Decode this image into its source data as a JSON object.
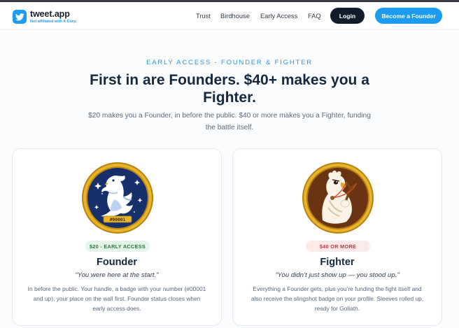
{
  "nav": {
    "brand_name": "tweet.app",
    "brand_sub": "Not affiliated with X Corp.",
    "links": [
      "Trust",
      "Birdhouse",
      "Early Access",
      "FAQ"
    ],
    "login_label": "Login",
    "cta_label": "Become a Founder"
  },
  "hero": {
    "eyebrow": "EARLY ACCESS - FOUNDER & FIGHTER",
    "headline": "First in are Founders. $40+ makes you a Fighter.",
    "subhead": "$20 makes you a Founder, in before the public. $40 or more makes you a Fighter, funding the battle itself."
  },
  "tiers": [
    {
      "badge_number": "#00001",
      "price": "$20 - EARLY ACCESS",
      "title": "Founder",
      "quote": "“You were here at the start.”",
      "body": "In before the public. Your handle, a badge with your number (#00001 and up), your place on the wall first. Founder status closes when early access does."
    },
    {
      "price": "$40 OR MORE",
      "title": "Fighter",
      "quote": "“You didn’t just show up — you stood up.”",
      "body": "Everything a Founder gets, plus you’re funding the fight itself and also receive the slingshot badge on your profile. Sleeves rolled up, ready for Goliath."
    }
  ],
  "colors": {
    "accent": "#1d9bf0",
    "dark": "#101c2b",
    "gold": "#d9a21b",
    "navy_badge": "#16306a",
    "brown_badge": "#6a3413"
  }
}
